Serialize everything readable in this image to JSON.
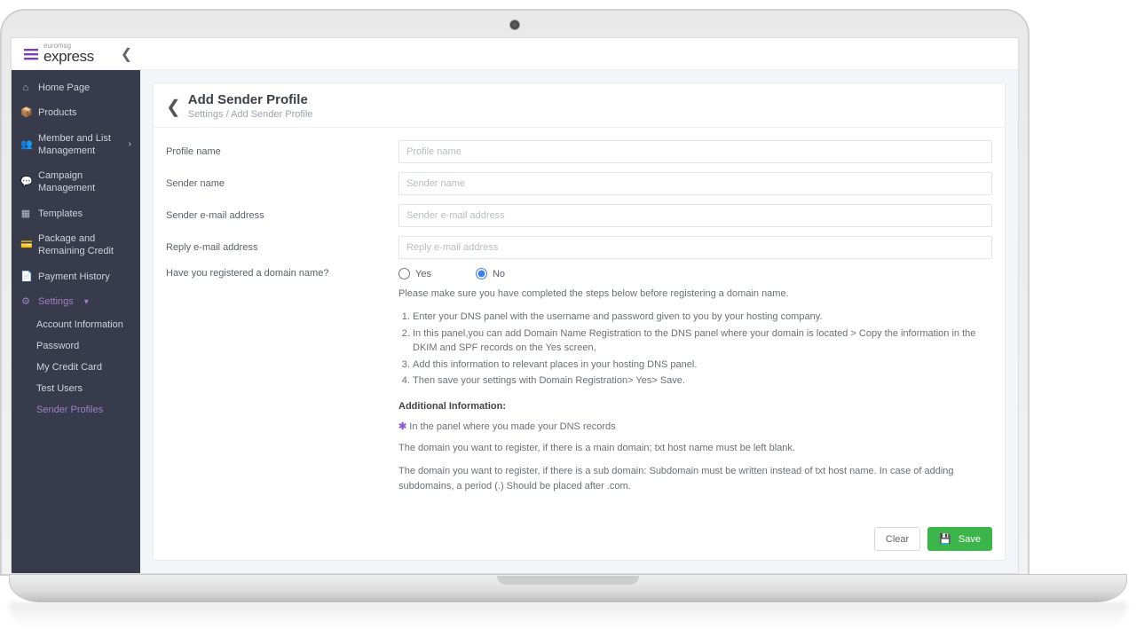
{
  "brand": {
    "sup": "euromsg",
    "name": "express"
  },
  "sidebar": {
    "items": [
      {
        "label": "Home Page"
      },
      {
        "label": "Products"
      },
      {
        "label": "Member and List Management"
      },
      {
        "label": "Campaign Management"
      },
      {
        "label": "Templates"
      },
      {
        "label": "Package and Remaining Credit"
      },
      {
        "label": "Payment History"
      },
      {
        "label": "Settings"
      }
    ],
    "subs": [
      {
        "label": "Account Information"
      },
      {
        "label": "Password"
      },
      {
        "label": "My Credit Card"
      },
      {
        "label": "Test Users"
      },
      {
        "label": "Sender Profiles"
      }
    ]
  },
  "page": {
    "title": "Add Sender Profile",
    "crumb_settings": "Settings",
    "crumb_sep": " / ",
    "crumb_page": "Add Sender Profile"
  },
  "form": {
    "profile_name_label": "Profile name",
    "profile_name_ph": "Profile name",
    "sender_name_label": "Sender name",
    "sender_name_ph": "Sender name",
    "sender_email_label": "Sender e-mail address",
    "sender_email_ph": "Sender e-mail address",
    "reply_email_label": "Reply e-mail address",
    "reply_email_ph": "Reply e-mail address",
    "domain_q": "Have you registered a domain name?",
    "yes": "Yes",
    "no": "No"
  },
  "info": {
    "lead": "Please make sure you have completed the steps below before registering a domain name.",
    "steps": {
      "1": "Enter your DNS panel with the username and password given to you by your hosting company.",
      "2": "In this panel,you can add Domain Name Registration to the DNS panel where your domain is located > Copy the information in the DKIM and SPF records on the Yes screen,",
      "3": "Add this information to relevant places in your hosting DNS panel.",
      "4": "Then save your settings with Domain Registration> Yes> Save."
    },
    "add_title": "Additional Information:",
    "star_line": "In the panel where you made your DNS records",
    "para1": "The domain you want to register, if there is a main domain; txt host name must be left blank.",
    "para2": "The domain you want to register, if there is a sub domain: Subdomain must be written instead of txt host name. In case of adding subdomains, a period (.) Should be placed after .com."
  },
  "actions": {
    "clear": "Clear",
    "save": "Save"
  }
}
